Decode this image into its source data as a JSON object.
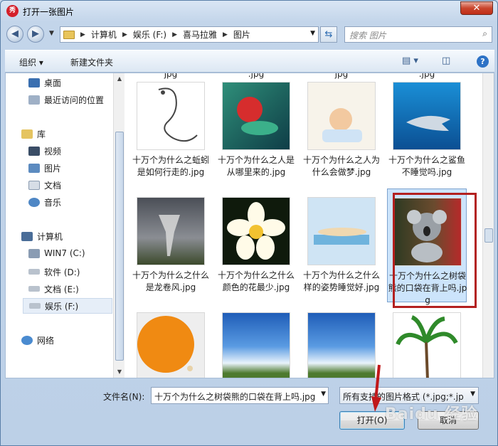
{
  "window": {
    "title": "打开一张图片",
    "app_icon_text": "秀",
    "close_label": "✕"
  },
  "address": {
    "crumbs": [
      "计算机",
      "娱乐 (F:)",
      "喜马拉雅",
      "图片"
    ]
  },
  "search": {
    "placeholder": "搜索 图片"
  },
  "toolbar": {
    "organize_label": "组织 ▾",
    "new_folder_label": "新建文件夹"
  },
  "sidebar": {
    "items": [
      {
        "label": "桌面",
        "icon": "desktop-icon"
      },
      {
        "label": "最近访问的位置",
        "icon": "recent-places-icon"
      },
      {
        "label": "库",
        "icon": "library-icon"
      },
      {
        "label": "视频",
        "icon": "video-icon"
      },
      {
        "label": "图片",
        "icon": "pictures-icon"
      },
      {
        "label": "文档",
        "icon": "documents-icon"
      },
      {
        "label": "音乐",
        "icon": "music-icon"
      },
      {
        "label": "计算机",
        "icon": "computer-icon"
      },
      {
        "label": "WIN7 (C:)",
        "icon": "system-drive-icon"
      },
      {
        "label": "软件 (D:)",
        "icon": "drive-icon"
      },
      {
        "label": "文档 (E:)",
        "icon": "drive-icon"
      },
      {
        "label": "娱乐 (F:)",
        "icon": "drive-icon"
      },
      {
        "label": "网络",
        "icon": "network-icon"
      }
    ]
  },
  "files": {
    "top_partial": [
      "jpg",
      ".jpg",
      "jpg",
      ".jpg"
    ],
    "items": [
      {
        "name": "十万个为什么之蚯蚓是如何行走的.jpg"
      },
      {
        "name": "十万个为什么之人是从哪里来的.jpg"
      },
      {
        "name": "十万个为什么之人为什么会做梦.jpg"
      },
      {
        "name": "十万个为什么之鲨鱼不睡觉吗.jpg"
      },
      {
        "name": "十万个为什么之什么是龙卷风.jpg"
      },
      {
        "name": "十万个为什么之什么颜色的花最少.jpg"
      },
      {
        "name": "十万个为什么之什么样的姿势睡觉好.jpg"
      },
      {
        "name": "十万个为什么之树袋熊的口袋在背上吗.jpg"
      }
    ]
  },
  "bottom": {
    "filename_label": "文件名(N):",
    "filename_value": "十万个为什么之树袋熊的口袋在背上吗.jpg",
    "filetype_value": "所有支持的图片格式 (*.jpg;*.jp",
    "open_label": "打开(O)",
    "cancel_label": "取消",
    "watermark": "Baidu 经验"
  }
}
